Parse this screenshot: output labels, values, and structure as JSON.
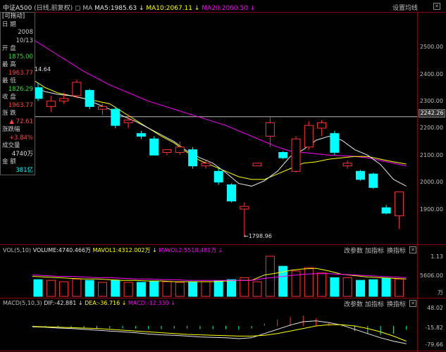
{
  "header": {
    "symbol": "中证A500",
    "adjust": "(日线,前复权)",
    "ma_label": "MA",
    "ma5": "MA5:1985.63",
    "ma10": "MA10:2067.11",
    "ma20": "MA20:2060.50",
    "settings": "设置均线"
  },
  "info_box": {
    "title": "[可拖动]",
    "date_label": "日  期",
    "date_year": "2008",
    "date_md": "10/13",
    "open_label": "开  盘",
    "open": "1875.00",
    "high_label": "最  高",
    "high": "1963.77",
    "low_label": "最  低",
    "low": "1826.29",
    "close_label": "收  盘",
    "close": "1963.77",
    "change_label": "涨  跌",
    "change": "▲ 72.61",
    "pct_label": "涨跌幅",
    "pct": "+3.84%",
    "volume_label": "成交量",
    "volume": "4740万",
    "amount_label": "金  额",
    "amount": "381亿"
  },
  "price_axis": [
    "2500.00",
    "2400.00",
    "2300.00",
    "2200.00",
    "2100.00",
    "2000.00",
    "1900.00"
  ],
  "crosshair_value": "2242.26",
  "high_marker": "14.64",
  "low_marker": "1798.96",
  "vol_header": {
    "name": "VOL(5,10)",
    "volume": "VOLUME:4740.466万",
    "mavol1": "MAVOL1:4312.002万",
    "mavol2": "MAVOL2:5518.481万",
    "btn_params": "改参数",
    "btn_add": "加指标",
    "btn_switch": "换指标"
  },
  "vol_axis": [
    "1.13",
    "5606.00",
    "万"
  ],
  "macd_header": {
    "name": "MACD(5,10,3)",
    "dif": "DIF:-42.881",
    "dea": "DEA:-36.716",
    "macd": "MACD:-12.330",
    "btn_params": "改参数",
    "btn_add": "加指标",
    "btn_switch": "换指标"
  },
  "macd_axis": [
    "48.02",
    "-15.82",
    "-79.66"
  ],
  "colors": {
    "up": "#ff3232",
    "down": "#00ffff",
    "ma5": "#e6e6e6",
    "ma10": "#ffff00",
    "ma20": "#ff00ff",
    "grid": "#8b0000"
  },
  "chart_data": {
    "type": "candlestick",
    "ylim": [
      1750,
      2560
    ],
    "candles": [
      {
        "o": 2350,
        "c": 2310,
        "h": 2370,
        "l": 2300
      },
      {
        "o": 2280,
        "c": 2300,
        "h": 2320,
        "l": 2260
      },
      {
        "o": 2300,
        "c": 2310,
        "h": 2330,
        "l": 2290
      },
      {
        "o": 2320,
        "c": 2370,
        "h": 2380,
        "l": 2310
      },
      {
        "o": 2340,
        "c": 2280,
        "h": 2345,
        "l": 2270
      },
      {
        "o": 2270,
        "c": 2280,
        "h": 2290,
        "l": 2250
      },
      {
        "o": 2270,
        "c": 2210,
        "h": 2280,
        "l": 2200
      },
      {
        "o": 2220,
        "c": 2230,
        "h": 2250,
        "l": 2200
      },
      {
        "o": 2180,
        "c": 2170,
        "h": 2190,
        "l": 2160
      },
      {
        "o": 2160,
        "c": 2100,
        "h": 2170,
        "l": 2100
      },
      {
        "o": 2110,
        "c": 2120,
        "h": 2120,
        "l": 2100
      },
      {
        "o": 2110,
        "c": 2130,
        "h": 2150,
        "l": 2100
      },
      {
        "o": 2120,
        "c": 2060,
        "h": 2130,
        "l": 2050
      },
      {
        "o": 2060,
        "c": 2070,
        "h": 2080,
        "l": 2050
      },
      {
        "o": 2040,
        "c": 2000,
        "h": 2050,
        "l": 1990
      },
      {
        "o": 1990,
        "c": 1930,
        "h": 1995,
        "l": 1925
      },
      {
        "o": 1900,
        "c": 1910,
        "h": 1925,
        "l": 1798.96
      },
      {
        "o": 2060,
        "c": 2070,
        "h": 2070,
        "l": 2060
      },
      {
        "o": 2170,
        "c": 2220,
        "h": 2245,
        "l": 2130
      },
      {
        "o": 2110,
        "c": 2090,
        "h": 2115,
        "l": 2085
      },
      {
        "o": 2040,
        "c": 2160,
        "h": 2170,
        "l": 2035
      },
      {
        "o": 2130,
        "c": 2210,
        "h": 2225,
        "l": 2120
      },
      {
        "o": 2200,
        "c": 2220,
        "h": 2230,
        "l": 2170
      },
      {
        "o": 2180,
        "c": 2110,
        "h": 2190,
        "l": 2100
      },
      {
        "o": 2060,
        "c": 2070,
        "h": 2080,
        "l": 2050
      },
      {
        "o": 2040,
        "c": 2010,
        "h": 2045,
        "l": 2005
      },
      {
        "o": 2030,
        "c": 1980,
        "h": 2035,
        "l": 1975
      },
      {
        "o": 1905,
        "c": 1885,
        "h": 1915,
        "l": 1880
      },
      {
        "o": 1875,
        "c": 1963.77,
        "h": 1963.77,
        "l": 1826.29
      }
    ],
    "ma5": [
      2355,
      2335,
      2325,
      2320,
      2310,
      2290,
      2270,
      2245,
      2225,
      2200,
      2175,
      2150,
      2115,
      2090,
      2070,
      2035,
      1995,
      1985,
      2005,
      2040,
      2095,
      2120,
      2155,
      2170,
      2155,
      2120,
      2100,
      2065,
      2010,
      1985
    ],
    "ma10": [
      2380,
      2350,
      2330,
      2320,
      2310,
      2300,
      2290,
      2260,
      2230,
      2200,
      2170,
      2145,
      2110,
      2080,
      2060,
      2040,
      2020,
      2010,
      2010,
      2030,
      2050,
      2070,
      2075,
      2085,
      2090,
      2095,
      2095,
      2085,
      2075,
      2067
    ],
    "ma20": [
      2530,
      2500,
      2470,
      2440,
      2410,
      2385,
      2360,
      2340,
      2320,
      2300,
      2285,
      2270,
      2255,
      2240,
      2225,
      2210,
      2190,
      2170,
      2150,
      2130,
      2115,
      2110,
      2105,
      2100,
      2098,
      2095,
      2090,
      2080,
      2070,
      2060
    ],
    "volume": [
      25,
      24,
      22,
      26,
      24,
      21,
      24,
      21,
      21,
      23,
      22,
      21,
      22,
      22,
      23,
      25,
      28,
      22,
      60,
      45,
      38,
      43,
      35,
      28,
      28,
      24,
      25,
      27,
      26
    ],
    "mavol1": [
      30,
      29,
      28,
      27,
      26,
      26,
      25,
      24,
      24,
      23,
      23,
      22,
      22,
      22,
      22,
      23,
      24,
      24,
      32,
      35,
      39,
      41,
      42,
      38,
      33,
      31,
      29,
      28,
      27,
      26
    ],
    "mavol2": [
      32,
      31,
      30,
      30,
      29,
      28,
      28,
      27,
      26,
      26,
      25,
      25,
      24,
      24,
      24,
      24,
      24,
      24,
      27,
      29,
      31,
      33,
      34,
      34,
      33,
      32,
      31,
      30,
      29,
      28
    ]
  }
}
